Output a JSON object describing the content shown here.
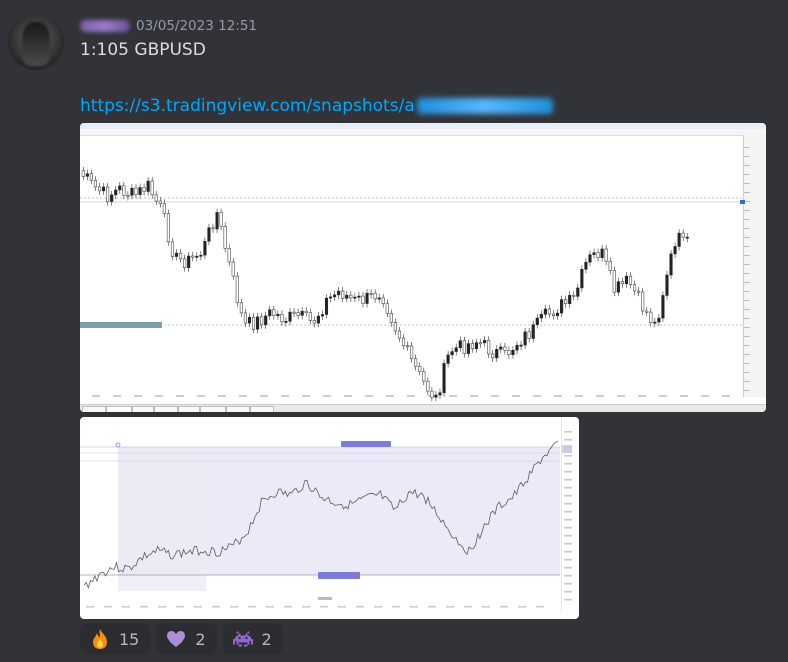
{
  "message": {
    "timestamp": "03/05/2023 12:51",
    "text": "1:105 GBPUSD",
    "link_visible": "https://s3.tradingview.com/snapshots/a"
  },
  "reactions": [
    {
      "emoji": "fire-icon",
      "count": "15"
    },
    {
      "emoji": "purple-heart-icon",
      "count": "2"
    },
    {
      "emoji": "space-invader-icon",
      "count": "2"
    }
  ],
  "colors": {
    "background": "#313338",
    "link": "#00a8fc",
    "timestamp": "#949ba4",
    "text": "#dbdee1",
    "reaction_bg": "#2b2d31",
    "tv_zone": "#eceaf7",
    "tv_label": "#7e7ad8"
  }
}
